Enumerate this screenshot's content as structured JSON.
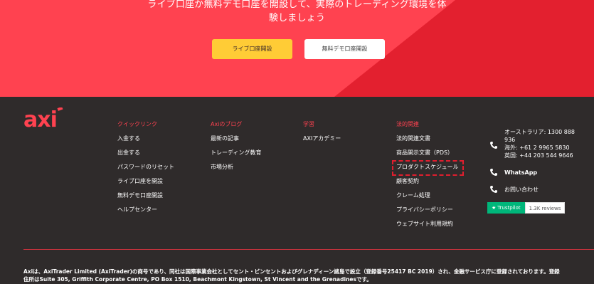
{
  "hero": {
    "text_line1": "ライブ口座か無料デモ口座を開設して、実際のトレーディング環境を体",
    "text_line2": "験しましょう",
    "live_button": "ライブ口座開設",
    "demo_button": "無料デモ口座開設"
  },
  "logo": {
    "text": "axi"
  },
  "columns": [
    {
      "heading": "クイックリンク",
      "links": [
        "入金する",
        "出金する",
        "パスワードのリセット",
        "ライブ口座を開設",
        "無料デモ口座開設",
        "ヘルプセンター"
      ]
    },
    {
      "heading": "Axiのブログ",
      "links": [
        "最新の記事",
        "トレーディング教育",
        "市場分析"
      ]
    },
    {
      "heading": "学習",
      "links": [
        "AXIアカデミー"
      ]
    },
    {
      "heading": "法的関連",
      "links": [
        "法的関連文書",
        "商品開示文書（PDS）",
        "プロダクトスケジュール",
        "顧客契約",
        "クレーム処理",
        "プライバシーポリシー",
        "ウェブサイト利用規約"
      ]
    }
  ],
  "contact": {
    "au_line1": "オーストラリア: 1300 888",
    "au_line2": "936",
    "overseas": "海外: +61 2 9965 5830",
    "uk": "英国: +44 203 544 9646",
    "whatsapp": "WhatsApp",
    "inquiry": "お問い合わせ"
  },
  "trustpilot": {
    "label": "Trustpilot",
    "reviews": "1.3K reviews"
  },
  "legal": {
    "line1": "Axiは、AxiTrader Limited (AxiTrader)の商号であり、同社は国際事業会社としてセント・ビンセントおよびグレナディーン諸島で設立（登録番号25417 BC 2019）され、金融サービス庁に登録されております。登録",
    "line2": "住所はSuite 305, Griffith Corporate Centre, PO Box 1510, Beachmont Kingstown, St Vincent and the Grenadinesです。"
  },
  "colors": {
    "brand_red": "#ff4250",
    "footer_bg": "#2f2b2b",
    "yellow": "#ffcc36",
    "trustpilot_green": "#00b67a"
  }
}
